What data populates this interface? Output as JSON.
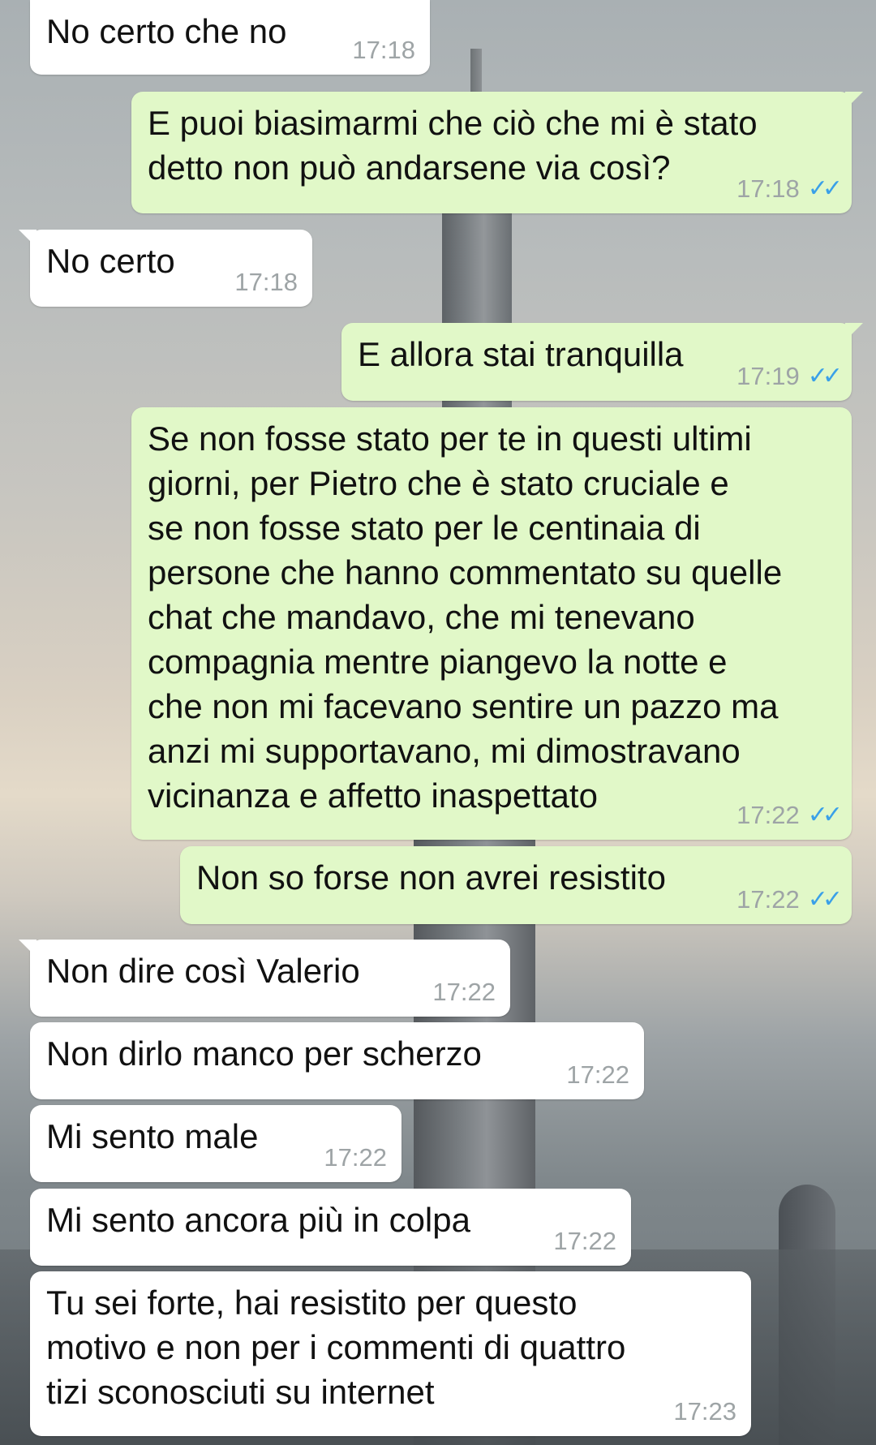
{
  "chat": {
    "messages": [
      {
        "side": "in",
        "text": "No certo che no",
        "time": "17:18"
      },
      {
        "side": "out",
        "text": "E puoi biasimarmi che ciò che mi è stato\ndetto non può andarsene via così?",
        "time": "17:18",
        "ticks": "✓✓"
      },
      {
        "side": "in",
        "text": "No certo",
        "time": "17:18"
      },
      {
        "side": "out",
        "text": "E allora stai tranquilla",
        "time": "17:19",
        "ticks": "✓✓"
      },
      {
        "side": "out",
        "text": "Se non fosse stato per te in questi ultimi\ngiorni, per Pietro che è stato cruciale e\nse non fosse stato per le centinaia di\npersone che hanno commentato su quelle\nchat che mandavo, che mi tenevano\ncompagnia mentre piangevo la notte e\nche non mi facevano sentire un pazzo ma\nanzi mi supportavano, mi dimostravano\nvicinanza e affetto inaspettato",
        "time": "17:22",
        "ticks": "✓✓"
      },
      {
        "side": "out",
        "text": "Non so forse non avrei resistito",
        "time": "17:22",
        "ticks": "✓✓"
      },
      {
        "side": "in",
        "text": "Non dire così Valerio",
        "time": "17:22"
      },
      {
        "side": "in",
        "text": "Non dirlo manco per scherzo",
        "time": "17:22"
      },
      {
        "side": "in",
        "text": "Mi sento male",
        "time": "17:22"
      },
      {
        "side": "in",
        "text": "Mi sento ancora più in colpa",
        "time": "17:22"
      },
      {
        "side": "in",
        "text": "Tu sei forte, hai resistito per questo\nmotivo e non per i commenti di quattro\ntizi sconosciuti su internet",
        "time": "17:23"
      }
    ]
  },
  "colors": {
    "incoming_bubble": "#ffffff",
    "outgoing_bubble": "#e1f8c8",
    "timestamp": "#9ea4a6",
    "read_ticks": "#3aa0e8"
  },
  "icons": {
    "read_receipt": "double-check-icon"
  }
}
